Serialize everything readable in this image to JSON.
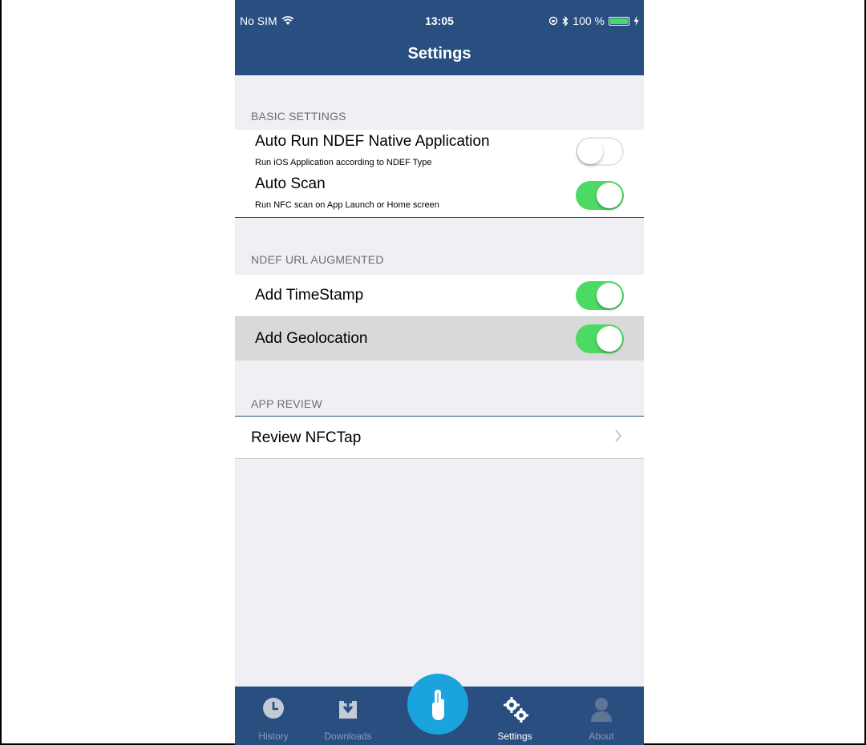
{
  "status_bar": {
    "carrier": "No SIM",
    "time": "13:05",
    "battery": "100 %",
    "battery_level": 1.0
  },
  "nav": {
    "title": "Settings"
  },
  "sections": {
    "basic": {
      "title": "BASIC SETTINGS",
      "auto_run": {
        "label": "Auto Run NDEF Native Application",
        "sub": "Run iOS Application according to NDEF Type",
        "on": false
      },
      "auto_scan": {
        "label": "Auto Scan",
        "sub": "Run NFC scan on App Launch or Home screen",
        "on": true
      }
    },
    "ndef": {
      "title": "NDEF URL AUGMENTED",
      "timestamp": {
        "label": "Add TimeStamp",
        "on": true
      },
      "geolocation": {
        "label": "Add Geolocation",
        "on": true
      }
    },
    "review": {
      "title": "APP REVIEW",
      "item": {
        "label": "Review NFCTap"
      }
    }
  },
  "tabbar": {
    "history": "History",
    "downloads": "Downloads",
    "settings": "Settings",
    "about": "About",
    "active": "settings"
  },
  "colors": {
    "nav_bg": "#294f81",
    "toggle_on": "#4cd964",
    "scan_button": "#1aa3dd"
  }
}
